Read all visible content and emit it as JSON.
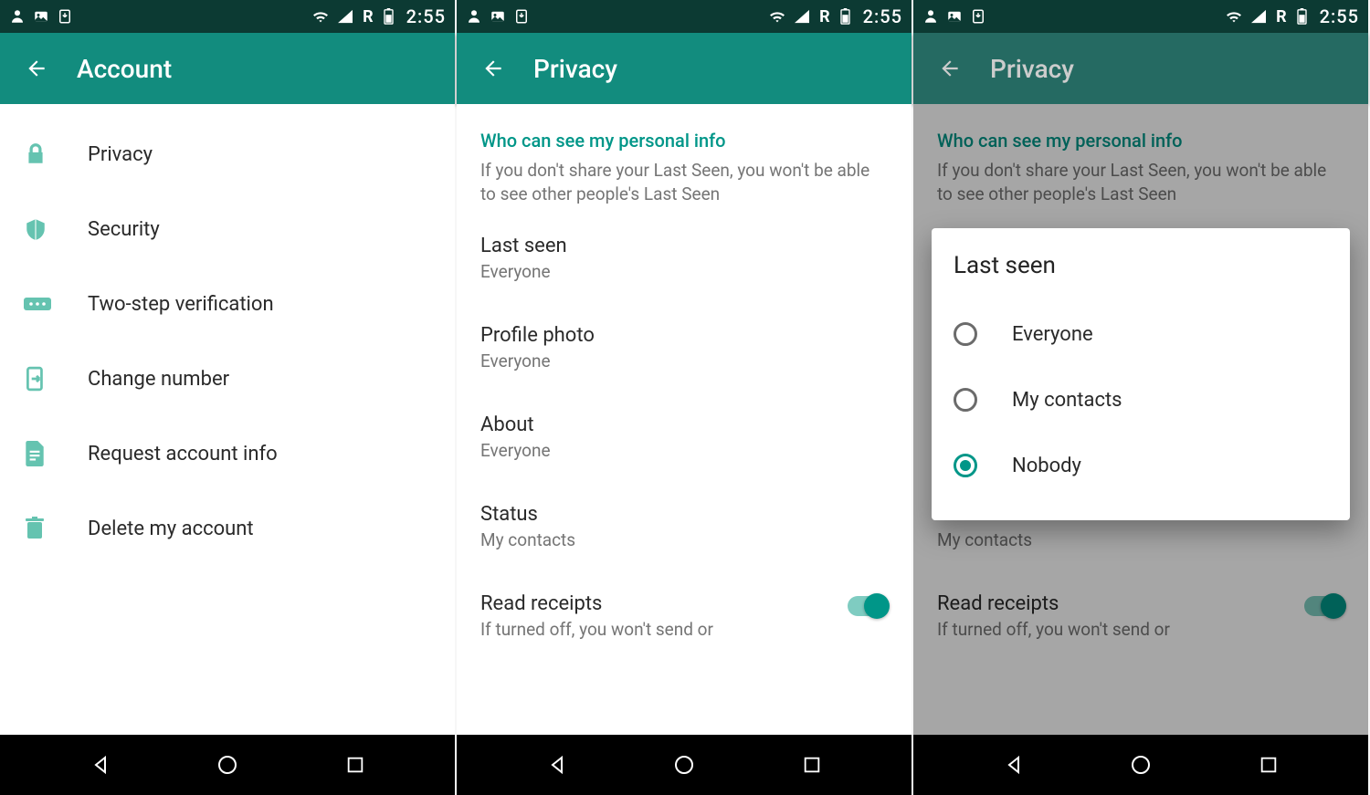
{
  "status": {
    "time": "2:55",
    "net_label": "R"
  },
  "screens": {
    "account": {
      "title": "Account",
      "items": [
        {
          "label": "Privacy",
          "icon": "lock-icon"
        },
        {
          "label": "Security",
          "icon": "shield-icon"
        },
        {
          "label": "Two-step verification",
          "icon": "pin-icon"
        },
        {
          "label": "Change number",
          "icon": "sim-swap-icon"
        },
        {
          "label": "Request account info",
          "icon": "document-icon"
        },
        {
          "label": "Delete my account",
          "icon": "trash-icon"
        }
      ]
    },
    "privacy": {
      "title": "Privacy",
      "section_header": "Who can see my personal info",
      "section_sub": "If you don't share your Last Seen, you won't be able to see other people's Last Seen",
      "items": [
        {
          "title": "Last seen",
          "value": "Everyone"
        },
        {
          "title": "Profile photo",
          "value": "Everyone"
        },
        {
          "title": "About",
          "value": "Everyone"
        },
        {
          "title": "Status",
          "value": "My contacts"
        }
      ],
      "read_receipts": {
        "title": "Read receipts",
        "sub": "If turned off, you won't send or",
        "enabled": true
      }
    },
    "dialog": {
      "title": "Last seen",
      "options": [
        {
          "label": "Everyone",
          "selected": false
        },
        {
          "label": "My contacts",
          "selected": false
        },
        {
          "label": "Nobody",
          "selected": true
        }
      ]
    }
  }
}
